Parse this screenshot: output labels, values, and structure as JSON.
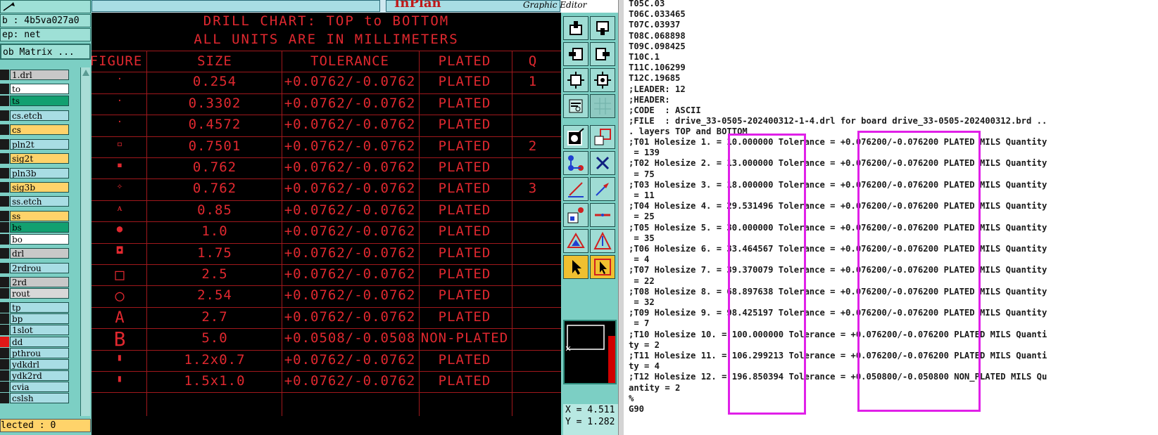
{
  "window": {
    "brand": "InPlan",
    "subtitle": "Graphic Editor"
  },
  "left_panel": {
    "job": "b : 4b5va027a0",
    "step": "ep: net",
    "matrix_button": "ob Matrix ...",
    "layers": [
      {
        "name": "1.drl",
        "color": "#c8c8c8"
      },
      {
        "name": "to",
        "color": "#ffffff"
      },
      {
        "name": "ts",
        "color": "#12a070"
      },
      {
        "name": "cs.etch",
        "color": "#a8dde4"
      },
      {
        "name": "cs",
        "color": "#ffd36a"
      },
      {
        "name": "pln2t",
        "color": "#a8dde4"
      },
      {
        "name": "sig2t",
        "color": "#ffd36a"
      },
      {
        "name": "pln3b",
        "color": "#a8dde4"
      },
      {
        "name": "sig3b",
        "color": "#ffd36a"
      },
      {
        "name": "ss.etch",
        "color": "#a8dde4"
      },
      {
        "name": "ss",
        "color": "#ffd36a"
      },
      {
        "name": "bs",
        "color": "#12a070"
      },
      {
        "name": "bo",
        "color": "#ffffff"
      },
      {
        "name": "drl",
        "color": "#c8c8c8"
      },
      {
        "name": "2rdrou",
        "color": "#a8dde4"
      },
      {
        "name": "2rd",
        "color": "#c8c8c8"
      },
      {
        "name": "rout",
        "color": "#d8d8d8"
      },
      {
        "name": "tp",
        "color": "#a8dde4"
      },
      {
        "name": "bp",
        "color": "#a8dde4"
      },
      {
        "name": "1slot",
        "color": "#a8dde4"
      },
      {
        "name": "dd",
        "color": "#a8dde4"
      },
      {
        "name": "pthrou",
        "color": "#a8dde4"
      },
      {
        "name": "ydkdrl",
        "color": "#a8dde4"
      },
      {
        "name": "ydk2rd",
        "color": "#a8dde4"
      },
      {
        "name": "cvia",
        "color": "#a8dde4"
      },
      {
        "name": "cslsh",
        "color": "#a8dde4"
      }
    ],
    "selected": "lected : 0"
  },
  "drill_chart": {
    "title1": "DRILL CHART: TOP to BOTTOM",
    "title2": "ALL UNITS ARE IN MILLIMETERS",
    "headers": [
      "FIGURE",
      "SIZE",
      "TOLERANCE",
      "PLATED",
      "Q"
    ],
    "rows": [
      {
        "figure": "·",
        "size": "0.254",
        "tol": "+0.0762/-0.0762",
        "plated": "PLATED",
        "q": "1"
      },
      {
        "figure": "·",
        "size": "0.3302",
        "tol": "+0.0762/-0.0762",
        "plated": "PLATED",
        "q": ""
      },
      {
        "figure": "·",
        "size": "0.4572",
        "tol": "+0.0762/-0.0762",
        "plated": "PLATED",
        "q": ""
      },
      {
        "figure": "▫",
        "size": "0.7501",
        "tol": "+0.0762/-0.0762",
        "plated": "PLATED",
        "q": "2"
      },
      {
        "figure": "▪",
        "size": "0.762",
        "tol": "+0.0762/-0.0762",
        "plated": "PLATED",
        "q": ""
      },
      {
        "figure": "✧",
        "size": "0.762",
        "tol": "+0.0762/-0.0762",
        "plated": "PLATED",
        "q": "3"
      },
      {
        "figure": "ᴀ",
        "size": "0.85",
        "tol": "+0.0762/-0.0762",
        "plated": "PLATED",
        "q": ""
      },
      {
        "figure": "●",
        "size": "1.0",
        "tol": "+0.0762/-0.0762",
        "plated": "PLATED",
        "q": ""
      },
      {
        "figure": "◘",
        "size": "1.75",
        "tol": "+0.0762/-0.0762",
        "plated": "PLATED",
        "q": ""
      },
      {
        "figure": "□",
        "size": "2.5",
        "tol": "+0.0762/-0.0762",
        "plated": "PLATED",
        "q": ""
      },
      {
        "figure": "○",
        "size": "2.54",
        "tol": "+0.0762/-0.0762",
        "plated": "PLATED",
        "q": ""
      },
      {
        "figure": "A",
        "size": "2.7",
        "tol": "+0.0762/-0.0762",
        "plated": "PLATED",
        "q": ""
      },
      {
        "figure": "B",
        "size": "5.0",
        "tol": "+0.0508/-0.0508",
        "plated": "NON-PLATED",
        "q": ""
      },
      {
        "figure": "▮",
        "size": "1.2x0.7",
        "tol": "+0.0762/-0.0762",
        "plated": "PLATED",
        "q": ""
      },
      {
        "figure": "▮",
        "size": "1.5x1.0",
        "tol": "+0.0762/-0.0762",
        "plated": "PLATED",
        "q": ""
      }
    ]
  },
  "coords": {
    "x": "X = 4.511",
    "y": "Y = 1.282"
  },
  "text_file": {
    "lines": [
      "T05C.03",
      "T06C.033465",
      "T07C.03937",
      "T08C.068898",
      "T09C.098425",
      "T10C.1",
      "T11C.106299",
      "T12C.19685",
      ";LEADER: 12",
      ";HEADER:",
      ";CODE  : ASCII",
      ";FILE  : drive_33-0505-202400312-1-4.drl for board drive_33-0505-202400312.brd ..",
      ". layers TOP and BOTTOM",
      ";T01 Holesize 1. = 10.000000 Tolerance = +0.076200/-0.076200 PLATED MILS Quantity",
      " = 139",
      ";T02 Holesize 2. = 13.000000 Tolerance = +0.076200/-0.076200 PLATED MILS Quantity",
      " = 75",
      ";T03 Holesize 3. = 18.000000 Tolerance = +0.076200/-0.076200 PLATED MILS Quantity",
      " = 11",
      ";T04 Holesize 4. = 29.531496 Tolerance = +0.076200/-0.076200 PLATED MILS Quantity",
      " = 25",
      ";T05 Holesize 5. = 30.000000 Tolerance = +0.076200/-0.076200 PLATED MILS Quantity",
      " = 35",
      ";T06 Holesize 6. = 33.464567 Tolerance = +0.076200/-0.076200 PLATED MILS Quantity",
      " = 4",
      ";T07 Holesize 7. = 39.370079 Tolerance = +0.076200/-0.076200 PLATED MILS Quantity",
      " = 22",
      ";T08 Holesize 8. = 68.897638 Tolerance = +0.076200/-0.076200 PLATED MILS Quantity",
      " = 32",
      ";T09 Holesize 9. = 98.425197 Tolerance = +0.076200/-0.076200 PLATED MILS Quantity",
      " = 7",
      ";T10 Holesize 10. = 100.000000 Tolerance = +0.076200/-0.076200 PLATED MILS Quanti",
      "ty = 2",
      ";T11 Holesize 11. = 106.299213 Tolerance = +0.076200/-0.076200 PLATED MILS Quanti",
      "ty = 4",
      ";T12 Holesize 12. = 196.850394 Tolerance = +0.050800/-0.050800 NON_PLATED MILS Qu",
      "antity = 2",
      "%",
      "G90"
    ]
  }
}
